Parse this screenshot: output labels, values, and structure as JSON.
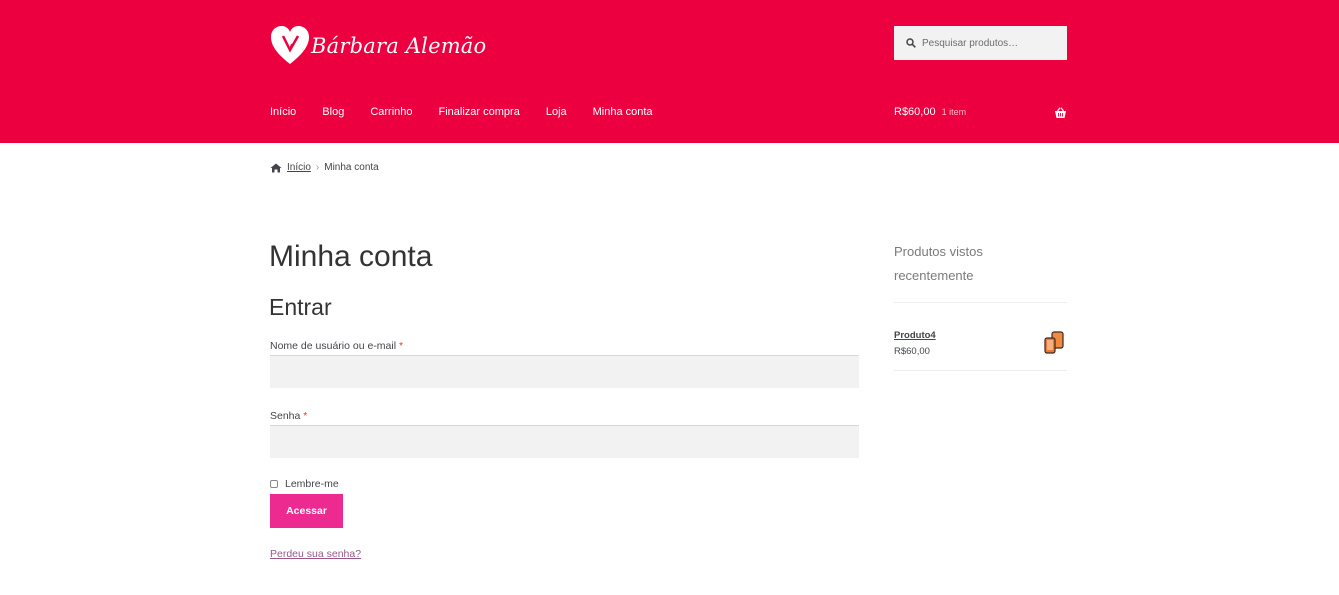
{
  "site": {
    "name": "Bárbara Alemão"
  },
  "search": {
    "placeholder": "Pesquisar produtos…"
  },
  "nav": {
    "items": [
      "Início",
      "Blog",
      "Carrinho",
      "Finalizar compra",
      "Loja",
      "Minha conta"
    ]
  },
  "cart": {
    "amount": "R$60,00",
    "count": "1 item"
  },
  "breadcrumb": {
    "home": "Início",
    "current": "Minha conta"
  },
  "page": {
    "title": "Minha conta",
    "subtitle": "Entrar"
  },
  "form": {
    "username_label": "Nome de usuário ou e-mail",
    "password_label": "Senha",
    "required_mark": "*",
    "remember_label": "Lembre-me",
    "submit_label": "Acessar",
    "lost_password": "Perdeu sua senha?"
  },
  "sidebar": {
    "widget_title": "Produtos vistos recentemente",
    "products": [
      {
        "name": "Produto4",
        "price": "R$60,00"
      }
    ]
  },
  "colors": {
    "header_bg": "#ed003f",
    "button_bg": "#ed2a8f",
    "link": "#96588a"
  },
  "icons": {
    "search": "search-icon",
    "cart": "basket-icon",
    "home": "home-icon",
    "logo": "heart-logo-icon"
  }
}
